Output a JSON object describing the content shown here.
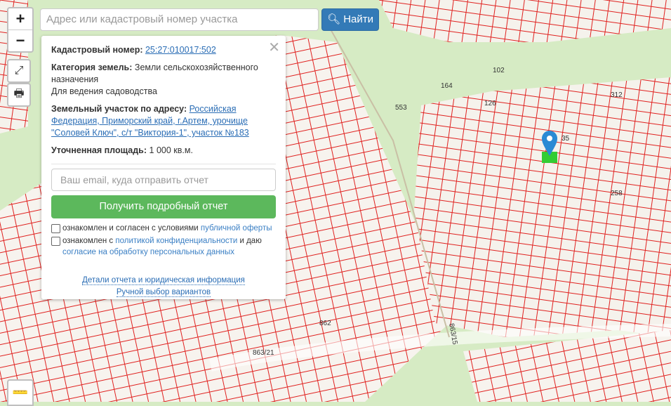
{
  "search": {
    "placeholder": "Адрес или кадастровый номер участка",
    "button": "Найти"
  },
  "controls": {
    "zoom_in": "+",
    "zoom_out": "−"
  },
  "popup": {
    "cadastral_label": "Кадастровый номер:",
    "cadastral_value": "25:27:010017:502",
    "category_label": "Категория земель:",
    "category_value": "Земли сельскохозяйственного назначения",
    "usage": "Для ведения садоводства",
    "address_label": "Земельный участок по адресу:",
    "address_value": "Российская Федерация, Приморский край, г.Артем, урочище \"Соловей Ключ\", с/т \"Виктория-1\", участок №183",
    "area_label": "Уточненная площадь:",
    "area_value": "1 000 кв.м.",
    "email_placeholder": "Ваш email, куда отправить отчет",
    "get_report": "Получить подробный отчет",
    "consent1_text": "ознакомлен и согласен с условиями ",
    "consent1_link": "публичной оферты",
    "consent2_text": "ознакомлен с ",
    "consent2_link": "политикой конфиденциальности",
    "consent2_mid": " и даю ",
    "consent2_link2": "согласие на обработку персональных данных",
    "details_link": "Детали отчета и юридическая информация",
    "manual_link": "Ручной выбор вариантов"
  },
  "map": {
    "labels": [
      "863/21",
      "863/15",
      "862",
      "102",
      "164",
      "258",
      "553",
      "312",
      "126",
      "35"
    ],
    "parcel_color": "#e0211f",
    "selected_color": "#33cc33",
    "marker_color": "#2a8ad4"
  }
}
